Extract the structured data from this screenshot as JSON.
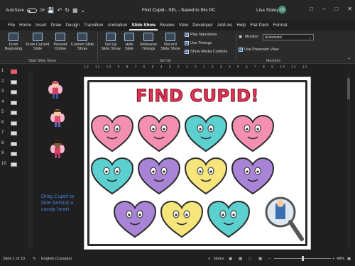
{
  "titlebar": {
    "autosave_label": "AutoSave",
    "autosave_state": "Off",
    "title": "Find Cupid - SEL - Saved to this PC",
    "user": "Lisa Staley",
    "avatar_initials": "LS"
  },
  "menu": {
    "tabs": [
      "File",
      "Home",
      "Insert",
      "Draw",
      "Design",
      "Transition",
      "Animation",
      "Slide Show",
      "Review",
      "View",
      "Developer",
      "Add-ins",
      "Help",
      "Flat Pack",
      "Format"
    ],
    "active": "Slide Show"
  },
  "ribbon": {
    "from_beginning": "From Beginning",
    "from_current": "From Current Slide",
    "present_online": "Present Online",
    "custom_show": "Custom Slide Show",
    "group_start": "Start Slide Show",
    "setup_show": "Set Up Slide Show",
    "hide_slide": "Hide Slide",
    "rehearse": "Rehearse Timings",
    "record": "Record Slide Show",
    "play_narrations": "Play Narrations",
    "use_timings": "Use Timings",
    "show_media": "Show Media Controls",
    "group_setup": "Set Up",
    "monitor_label": "Monitor:",
    "monitor_value": "Automatic",
    "presenter_view": "Use Presenter View",
    "group_monitors": "Monitors"
  },
  "slides": [
    "1",
    "2",
    "3",
    "4",
    "5",
    "6",
    "7",
    "8",
    "9",
    "10"
  ],
  "slide": {
    "title": "FIND CUPID!",
    "instruction": "Drag Cupid to hide behind a candy heart."
  },
  "ruler": {
    "top": "12 · 11 · 10 · 9 · 8 · 7 · 6 · 5 · 4 · 3 · 2 · 1 · 0 · 1 · 2 · 3 · 4 · 5 · 6 · 7 · 8 · 9 · 10 · 11 · 12"
  },
  "status": {
    "slide_count": "Slide 1 of 10",
    "language": "English (Canada)",
    "notes": "Notes",
    "zoom": "48%"
  },
  "colors": {
    "pink": "#f58fb1",
    "teal": "#5ccfcf",
    "purple": "#a984d6",
    "yellow": "#f6e57a",
    "title_red": "#e03552"
  }
}
